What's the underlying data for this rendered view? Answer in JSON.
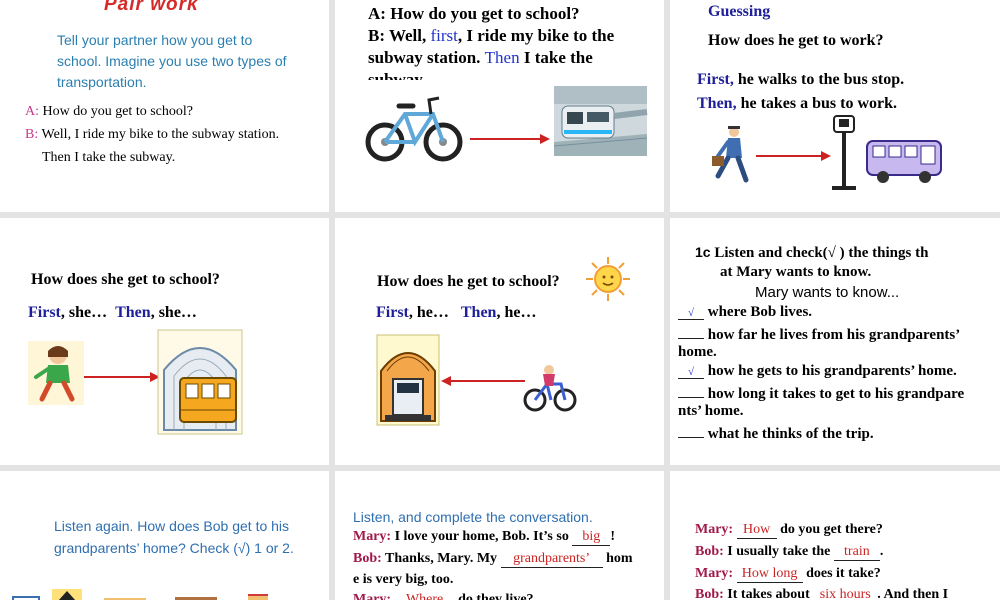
{
  "slide1": {
    "title": "Pair work",
    "instruction_1": "Tell your partner how you get to",
    "instruction_2": "school. Imagine you use two types of",
    "instruction_3": "transportation.",
    "a_label": "A:",
    "a_text": "How do you get to school?",
    "b_label": "B:",
    "b_text": "Well, I ride my bike to the subway station.",
    "b_text2": "Then I take the subway."
  },
  "slide2": {
    "line1": "A: How do you get to school?",
    "line2_a": "B: Well,",
    "line2_first": "first",
    "line2_b": ", I ride my bike to the",
    "line3_a": "subway station.",
    "line3_then": "Then",
    "line3_b": "I take the",
    "line4": "subway."
  },
  "slide3": {
    "title": "Guessing",
    "question": "How does he get to work?",
    "first_label": "First,",
    "first_text": "he walks to the bus stop.",
    "then_label": "Then,",
    "then_text": "he takes a bus to work."
  },
  "slide4": {
    "question": "How does she get to school?",
    "first_label": "First",
    "first_text": ", she…",
    "then_label": "Then",
    "then_text": ", she…"
  },
  "slide5": {
    "question": "How does he get to school?",
    "first_label": "First",
    "first_text": ", he…",
    "then_label": "Then",
    "then_text": ", he…"
  },
  "slide6": {
    "tag": "1c",
    "title_1": "Listen and check(√ ) the things th",
    "title_2": "at Mary wants to know.",
    "subtitle": "Mary wants to know...",
    "items": [
      {
        "check": "√",
        "text": "where Bob lives."
      },
      {
        "check": "",
        "text": "how far he lives from his grandparents’",
        "cont": "home."
      },
      {
        "check": "√",
        "text": "how he gets to his grandparents’ home."
      },
      {
        "check": "",
        "text": "how long it takes to get to his grandpare",
        "cont": "nts’ home."
      },
      {
        "check": "",
        "text": "what he thinks of the trip."
      }
    ]
  },
  "slide7": {
    "line1": "Listen again. How does Bob get to his",
    "line2": "grandparents’ home? Check (√) 1 or 2."
  },
  "slide8": {
    "title": "Listen, and complete the conversation.",
    "mary_label": "Mary:",
    "mary_text_a": "I love your home, Bob. It’s so",
    "mary_fill": "big",
    "mary_text_b": "!",
    "bob_label": "Bob:",
    "bob_text_a": "Thanks, Mary. My",
    "bob_fill": "grandparents’",
    "bob_text_b": "hom",
    "bob_text_c": "e is very big, too.",
    "mary2_fill": "Where",
    "mary2_text": "do they live?"
  },
  "slide9": {
    "l1_label": "Mary:",
    "l1_fill": "How",
    "l1_text": "do you get there?",
    "l2_label": "Bob:",
    "l2_text_a": "I usually take the",
    "l2_fill": "train",
    "l2_text_b": ".",
    "l3_label": "Mary:",
    "l3_fill": "How long",
    "l3_text": "does it take?",
    "l4_label": "Bob:",
    "l4_text_a": "It takes about",
    "l4_fill": "six hours",
    "l4_text_b": ". And then I"
  },
  "colors": {
    "navy": "#1f1f99",
    "link_blue": "#2233cc",
    "fill_red": "#cc2222",
    "label_maroon": "#a0194a",
    "instruction_teal": "#2a7fb0",
    "background_gray": "#e3e3e3"
  }
}
